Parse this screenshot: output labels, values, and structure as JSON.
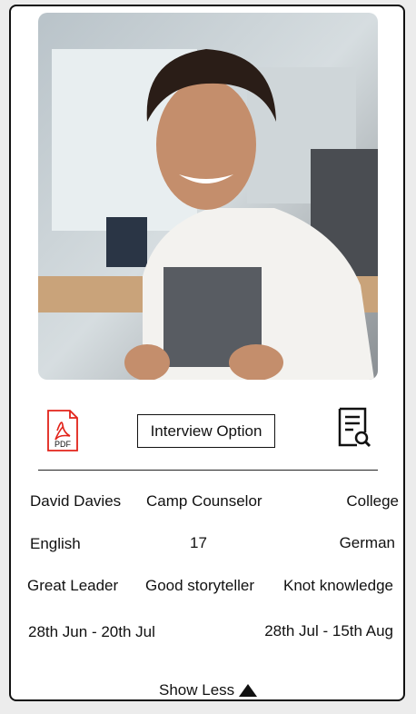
{
  "profile": {
    "name": "David Davies",
    "role": "Camp Counselor",
    "education": "College",
    "language_primary": "English",
    "age": "17",
    "language_secondary": "German",
    "traits": [
      "Great Leader",
      "Good storyteller",
      "Knot knowledge"
    ],
    "availability": [
      "28th Jun - 20th Jul",
      "28th Jul - 15th Aug"
    ]
  },
  "actions": {
    "pdf_label": "PDF",
    "interview_label": "Interview Option",
    "toggle_label": "Show Less"
  },
  "icons": {
    "pdf": "pdf-icon",
    "review": "document-search-icon",
    "toggle": "triangle-up-icon"
  },
  "colors": {
    "pdf_red": "#e2231a",
    "border": "#111111"
  }
}
